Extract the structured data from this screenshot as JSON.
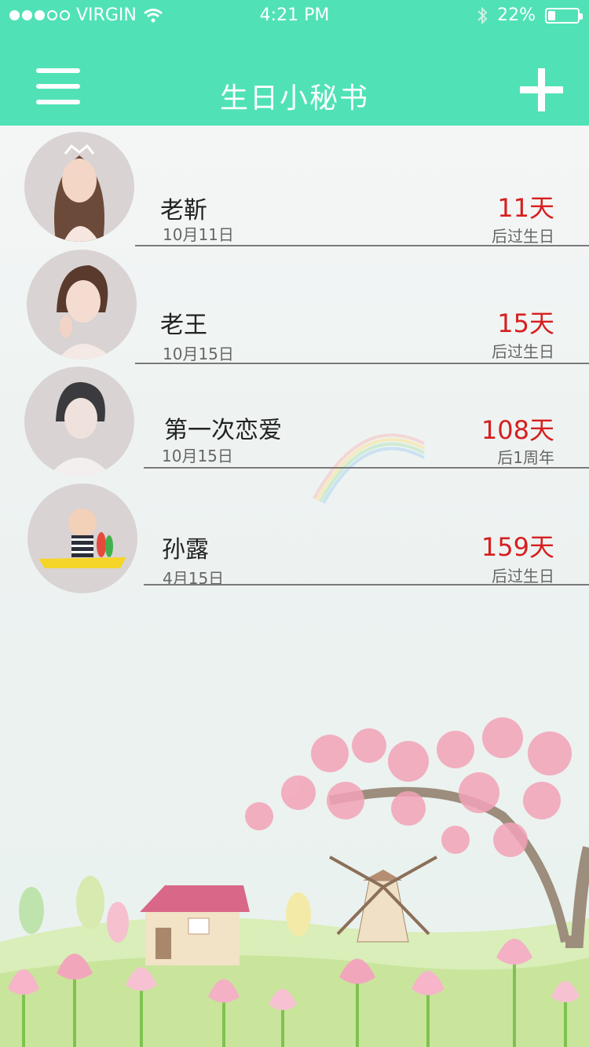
{
  "status_bar": {
    "carrier": "VIRGIN",
    "time": "4:21 PM",
    "battery": "22%",
    "battery_level": 0.22
  },
  "header": {
    "title": "生日小秘书",
    "menu_icon": "hamburger-menu-icon",
    "add_icon": "plus-icon"
  },
  "contacts": [
    {
      "name": "老靳",
      "date": "10月11日",
      "days": "11天",
      "note": "后过生日"
    },
    {
      "name": "老王",
      "date": "10月15日",
      "days": "15天",
      "note": "后过生日"
    },
    {
      "name": "第一次恋爱",
      "date": "10月15日",
      "days": "108天",
      "note": "后1周年"
    },
    {
      "name": "孙露",
      "date": "4月15日",
      "days": "159天",
      "note": "后过生日"
    }
  ],
  "colors": {
    "accent": "#50e2b6",
    "days_red": "#d61f1f"
  }
}
